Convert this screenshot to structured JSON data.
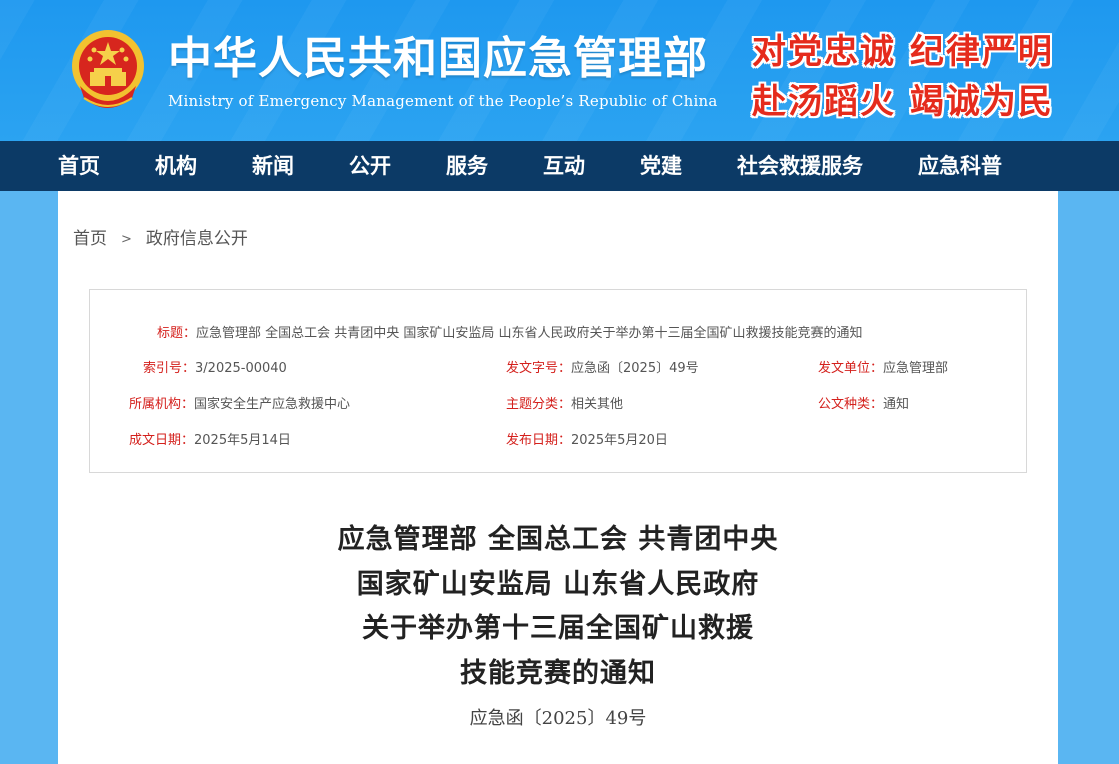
{
  "header": {
    "title": "中华人民共和国应急管理部",
    "subtitle": "Ministry of Emergency Management of the People’s Republic of China",
    "slogan_line1": "对党忠诚 纪律严明",
    "slogan_line2": "赴汤蹈火 竭诚为民",
    "emblem_icon": "national-emblem-icon"
  },
  "nav": {
    "items": [
      {
        "label": "首页"
      },
      {
        "label": "机构"
      },
      {
        "label": "新闻"
      },
      {
        "label": "公开"
      },
      {
        "label": "服务"
      },
      {
        "label": "互动"
      },
      {
        "label": "党建"
      },
      {
        "label": "社会救援服务"
      },
      {
        "label": "应急科普"
      }
    ]
  },
  "breadcrumb": {
    "home": "首页",
    "separator": ">",
    "current": "政府信息公开"
  },
  "info": {
    "title_label": "标题：",
    "title_value": "应急管理部 全国总工会 共青团中央 国家矿山安监局 山东省人民政府关于举办第十三届全国矿山救援技能竞赛的通知",
    "index_label": "索引号：",
    "index_value": "3/2025-00040",
    "docnum_label": "发文字号：",
    "docnum_value": "应急函〔2025〕49号",
    "issuer_label": "发文单位：",
    "issuer_value": "应急管理部",
    "org_label": "所属机构：",
    "org_value": "国家安全生产应急救援中心",
    "topic_label": "主题分类：",
    "topic_value": "相关其他",
    "type_label": "公文种类：",
    "type_value": "通知",
    "created_label": "成文日期：",
    "created_value": "2025年5月14日",
    "published_label": "发布日期：",
    "published_value": "2025年5月20日"
  },
  "document": {
    "title_lines": [
      "应急管理部  全国总工会  共青团中央",
      "国家矿山安监局  山东省人民政府",
      "关于举办第十三届全国矿山救援",
      "技能竞赛的通知"
    ],
    "doc_number": "应急函〔2025〕49号"
  },
  "colors": {
    "header_blue": "#1e98ef",
    "nav_bg": "#0c3a66",
    "label_red": "#d4201c",
    "slogan_red": "#e52b1c",
    "page_bg": "#5ab6f2"
  }
}
